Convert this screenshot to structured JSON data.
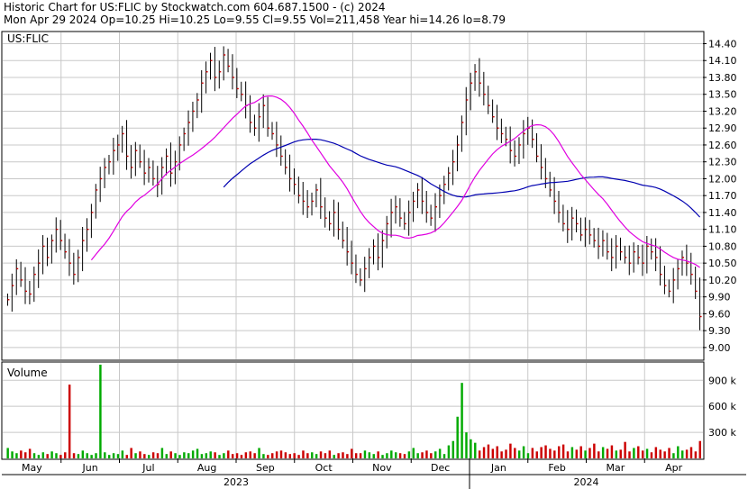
{
  "header": {
    "line1": "Historic Chart for US:FLIC by Stockwatch.com 604.687.1500 - (c) 2024",
    "line2": "Mon Apr 29 2024  Op=10.25  Hi=10.25  Lo=9.55  Cl=9.55  Vol=211,458  Year hi=14.26  lo=8.79"
  },
  "price_panel": {
    "symbol_label": "US:FLIC"
  },
  "volume_panel": {
    "label": "Volume"
  },
  "colors": {
    "ma_short": "#e000e0",
    "ma_long": "#0000b0",
    "bar": "#000000",
    "close_tick": "#cc0000",
    "vol_up": "#00aa00",
    "vol_down": "#cc0000",
    "grid": "#c8c8c8"
  },
  "chart_data": {
    "type": "ohlc",
    "ylim": [
      8.79,
      14.6
    ],
    "yticks": [
      "14.40",
      "14.10",
      "13.80",
      "13.50",
      "13.20",
      "12.90",
      "12.60",
      "12.30",
      "12.00",
      "11.70",
      "11.40",
      "11.10",
      "10.80",
      "10.50",
      "10.20",
      "9.90",
      "9.60",
      "9.30",
      "9.00"
    ],
    "volume_ticks": [
      "900 k",
      "600 k",
      "300 k"
    ],
    "volume_ylim": [
      0,
      1100
    ],
    "months": [
      "May",
      "Jun",
      "Jul",
      "Aug",
      "Sep",
      "Oct",
      "Nov",
      "Dec",
      "Jan",
      "Feb",
      "Mar",
      "Apr"
    ],
    "years": [
      "2023",
      "2024"
    ],
    "close": [
      9.85,
      10.1,
      10.4,
      10.2,
      10.0,
      9.95,
      10.3,
      10.5,
      10.8,
      10.6,
      10.9,
      11.1,
      10.9,
      10.7,
      10.5,
      10.3,
      10.6,
      10.9,
      11.1,
      11.4,
      11.8,
      12.0,
      12.2,
      12.3,
      12.5,
      12.6,
      12.8,
      12.4,
      12.2,
      12.5,
      12.3,
      12.1,
      12.2,
      12.0,
      11.9,
      12.2,
      12.4,
      12.1,
      12.3,
      12.6,
      12.8,
      13.0,
      13.2,
      13.4,
      13.7,
      13.9,
      14.1,
      13.8,
      13.9,
      14.2,
      14.0,
      13.8,
      13.6,
      13.5,
      13.3,
      13.0,
      12.9,
      13.1,
      13.3,
      12.9,
      12.8,
      12.6,
      12.4,
      12.2,
      12.0,
      11.9,
      11.7,
      11.6,
      11.5,
      11.6,
      11.8,
      11.5,
      11.3,
      11.2,
      11.4,
      11.1,
      10.9,
      10.7,
      10.5,
      10.3,
      10.2,
      10.4,
      10.6,
      10.8,
      10.6,
      10.9,
      11.2,
      11.4,
      11.5,
      11.3,
      11.2,
      11.4,
      11.6,
      11.8,
      11.6,
      11.4,
      11.3,
      11.5,
      11.7,
      11.9,
      12.1,
      12.3,
      12.6,
      13.0,
      13.4,
      13.7,
      13.9,
      13.7,
      13.5,
      13.3,
      13.1,
      12.9,
      12.8,
      12.7,
      12.5,
      12.4,
      12.6,
      12.8,
      12.9,
      12.7,
      12.4,
      12.2,
      12.0,
      11.8,
      11.6,
      11.4,
      11.2,
      11.1,
      11.3,
      11.2,
      11.0,
      11.1,
      11.0,
      10.9,
      10.8,
      10.9,
      10.7,
      10.6,
      10.8,
      10.7,
      10.6,
      10.5,
      10.7,
      10.6,
      10.5,
      10.8,
      10.7,
      10.6,
      10.3,
      10.1,
      10.0,
      10.2,
      10.4,
      10.6,
      10.5,
      10.3,
      10.0,
      9.55
    ],
    "volume": [
      120,
      80,
      60,
      90,
      70,
      110,
      60,
      40,
      70,
      50,
      80,
      60,
      40,
      70,
      850,
      60,
      50,
      90,
      60,
      40,
      60,
      1080,
      70,
      40,
      60,
      50,
      90,
      40,
      120,
      60,
      80,
      50,
      40,
      70,
      60,
      120,
      50,
      80,
      60,
      40,
      70,
      60,
      90,
      110,
      50,
      60,
      80,
      70,
      40,
      60,
      90,
      50,
      60,
      40,
      70,
      80,
      60,
      120,
      50,
      40,
      60,
      80,
      90,
      70,
      50,
      60,
      40,
      90,
      60,
      70,
      50,
      80,
      60,
      90,
      40,
      60,
      70,
      50,
      110,
      60,
      60,
      90,
      70,
      50,
      80,
      40,
      60,
      90,
      70,
      60,
      50,
      80,
      120,
      60,
      70,
      90,
      60,
      80,
      110,
      50,
      150,
      200,
      480,
      870,
      300,
      220,
      180,
      90,
      130,
      160,
      110,
      140,
      80,
      100,
      170,
      120,
      90,
      140,
      60,
      120,
      80,
      130,
      150,
      110,
      90,
      140,
      160,
      80,
      130,
      100,
      140,
      90,
      120,
      170,
      80,
      130,
      110,
      150,
      90,
      100,
      190,
      80,
      120,
      140,
      90,
      110,
      70,
      130,
      100,
      80,
      120,
      60,
      140,
      90,
      100,
      130,
      80,
      200
    ]
  }
}
